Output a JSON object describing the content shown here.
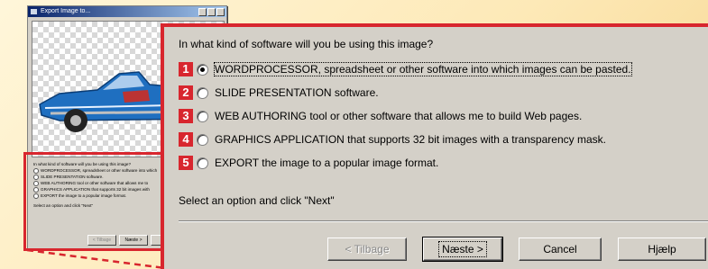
{
  "window": {
    "title": "Export Image to..."
  },
  "question": "In what kind of software will you be using this image?",
  "options": [
    {
      "num": "1",
      "prefix": "WORDPROCESSOR",
      "text": "WORDPROCESSOR, spreadsheet or other software into which images can be pasted.",
      "selected": true
    },
    {
      "num": "2",
      "text": "SLIDE PRESENTATION software.",
      "selected": false
    },
    {
      "num": "3",
      "text": "WEB AUTHORING tool or other software that allows me to build Web pages.",
      "selected": false
    },
    {
      "num": "4",
      "text": "GRAPHICS APPLICATION that supports 32 bit images with a transparency mask.",
      "selected": false
    },
    {
      "num": "5",
      "text": "EXPORT the image to a popular image format.",
      "selected": false
    }
  ],
  "hint": "Select an option and click \"Next\"",
  "buttons": {
    "back": "< Tilbage",
    "next": "Næste >",
    "cancel": "Cancel",
    "help": "Hjælp"
  },
  "mini": {
    "question": "In what kind of software will you be using this image?",
    "options": [
      "WORDPROCESSOR, spreadsheet or other software into which",
      "SLIDE PRESENTATION software.",
      "WEB AUTHORING tool or other software that allows me to",
      "GRAPHICS APPLICATION that supports 32 bit images with",
      "EXPORT the image to a popular image format."
    ],
    "hint": "Select an option and click \"Next\"",
    "back": "< Tilbage",
    "next": "Næste >"
  },
  "colors": {
    "accent": "#d8262e",
    "dialog": "#d4d0c8",
    "car": "#1f6fc0"
  }
}
